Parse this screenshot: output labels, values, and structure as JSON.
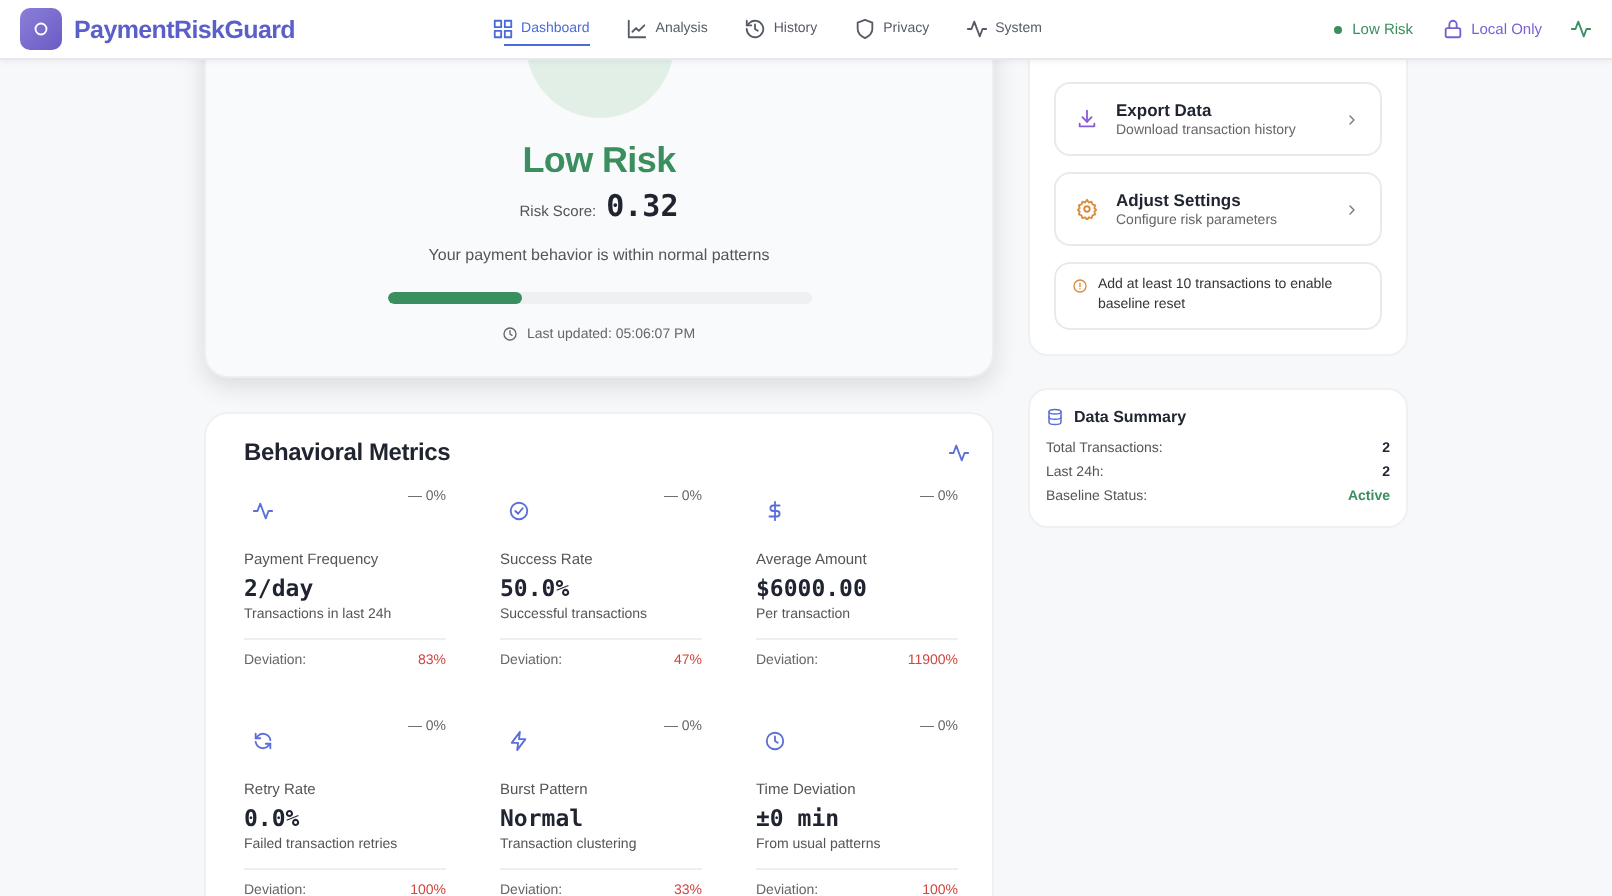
{
  "header": {
    "brand": "PaymentRiskGuard",
    "nav": [
      {
        "label": "Dashboard",
        "selected": true
      },
      {
        "label": "Analysis",
        "selected": false
      },
      {
        "label": "History",
        "selected": false
      },
      {
        "label": "Privacy",
        "selected": false
      },
      {
        "label": "System",
        "selected": false
      }
    ],
    "risk_status": "Low Risk",
    "privacy_mode": "Local Only"
  },
  "risk_card": {
    "level_label": "Low Risk",
    "score_label": "Risk Score:",
    "score": "0.32",
    "message": "Your payment behavior is within normal patterns",
    "level": 0.32,
    "last_updated": "Last updated: 05:06:07 PM"
  },
  "actions": [
    {
      "title": "Export Data",
      "subtitle": "Download transaction history"
    },
    {
      "title": "Adjust Settings",
      "subtitle": "Configure risk parameters"
    }
  ],
  "notice": "Add at least 10 transactions to enable baseline reset",
  "data_summary": {
    "title": "Data Summary",
    "rows": [
      {
        "label": "Total Transactions:",
        "value": "2",
        "kind": "count"
      },
      {
        "label": "Last 24h:",
        "value": "2",
        "kind": "count"
      },
      {
        "label": "Baseline Status:",
        "value": "Active",
        "kind": "status"
      }
    ]
  },
  "metrics": {
    "title": "Behavioral Metrics",
    "items": [
      {
        "label": "Payment Frequency",
        "value": "2/day",
        "subtitle": "Transactions in last 24h",
        "change": "— 0%",
        "deviation_label": "Deviation:",
        "deviation": "83%"
      },
      {
        "label": "Success Rate",
        "value": "50.0%",
        "subtitle": "Successful transactions",
        "change": "— 0%",
        "deviation_label": "Deviation:",
        "deviation": "47%"
      },
      {
        "label": "Average Amount",
        "value": "$6000.00",
        "subtitle": "Per transaction",
        "change": "— 0%",
        "deviation_label": "Deviation:",
        "deviation": "11900%"
      },
      {
        "label": "Retry Rate",
        "value": "0.0%",
        "subtitle": "Failed transaction retries",
        "change": "— 0%",
        "deviation_label": "Deviation:",
        "deviation": "100%"
      },
      {
        "label": "Burst Pattern",
        "value": "Normal",
        "subtitle": "Transaction clustering",
        "change": "— 0%",
        "deviation_label": "Deviation:",
        "deviation": "33%"
      },
      {
        "label": "Time Deviation",
        "value": "±0 min",
        "subtitle": "From usual patterns",
        "change": "— 0%",
        "deviation_label": "Deviation:",
        "deviation": "100%"
      }
    ]
  }
}
